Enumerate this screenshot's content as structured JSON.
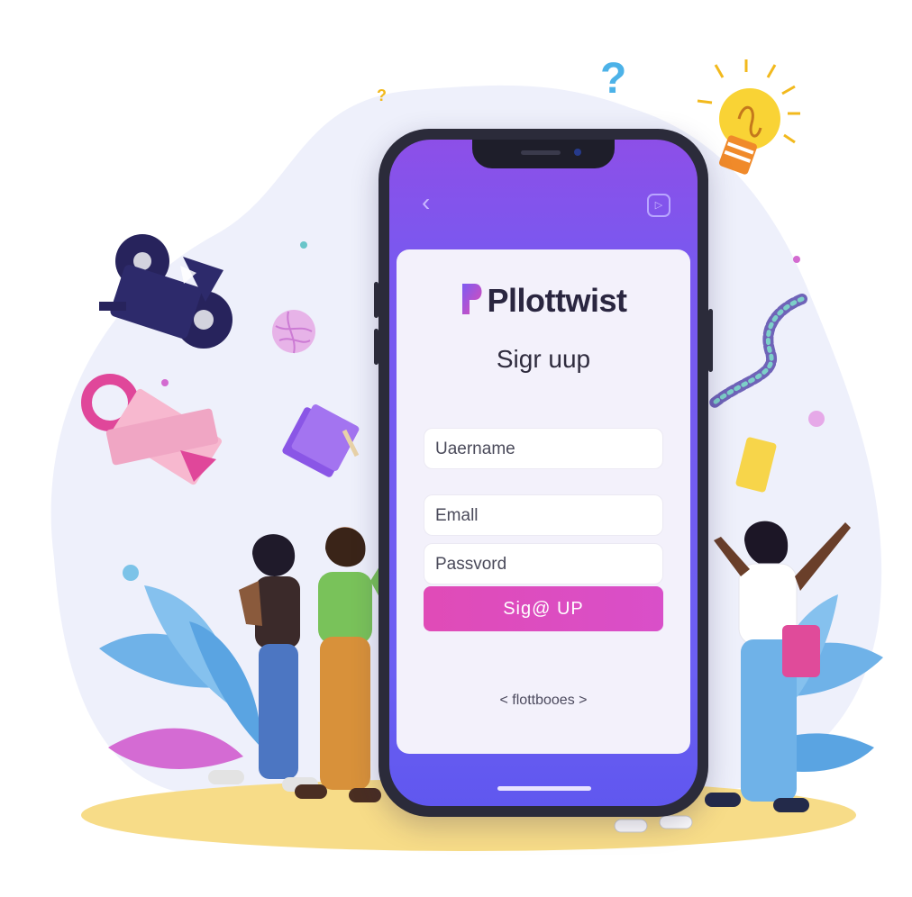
{
  "app": {
    "brand_name": "Pllottwist",
    "heading": "Sigr uup",
    "username_placeholder": "Uaername",
    "email_placeholder": "Emall",
    "password_placeholder": "Passvord",
    "signup_label": "Sig@ UP",
    "footer_link": "< flottbooes >",
    "back_icon": "chevron-left-icon",
    "top_right_icon": "play-icon"
  },
  "decor": {
    "question_mark_large": "?",
    "question_mark_small": "?"
  },
  "colors": {
    "primary_purple": "#8d4fe8",
    "primary_indigo": "#6057ef",
    "accent_pink": "#e04bb7",
    "card_bg": "#f3f1fb",
    "blob_bg": "#eef0fb",
    "ground": "#f7dc88"
  }
}
